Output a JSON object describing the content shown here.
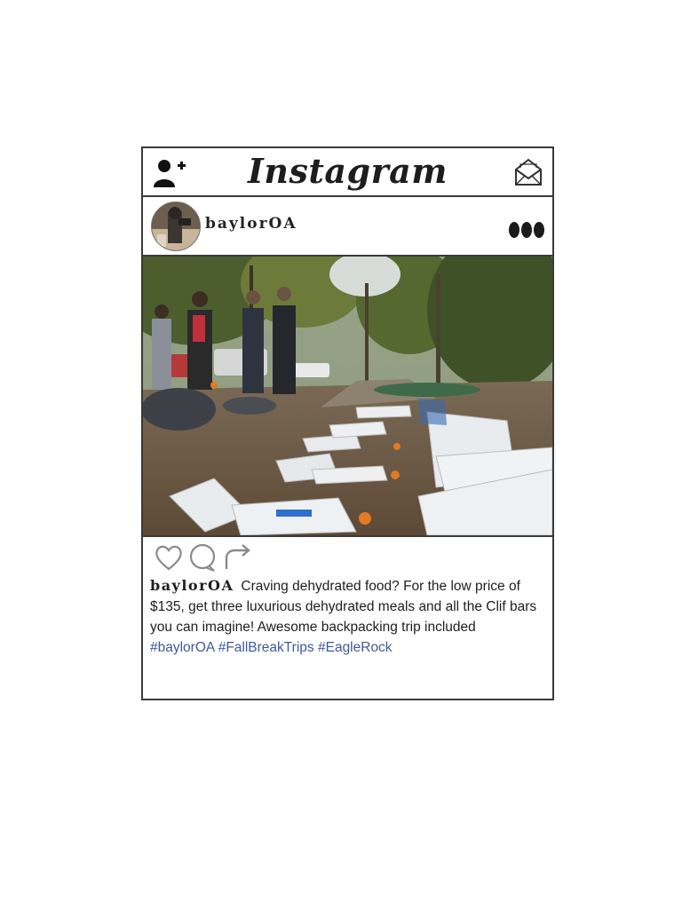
{
  "app": {
    "logo_text": "Instagram",
    "icons": {
      "add_user": "add-user-icon",
      "messages": "envelope-icon",
      "more": "more-options-icon",
      "like": "heart-icon",
      "comment": "comment-icon",
      "share": "share-arrow-icon"
    }
  },
  "post": {
    "username": "baylorOA",
    "image_description_icon": "post-photo",
    "caption": {
      "username": "baylorOA",
      "text": "Craving dehydrated food? For the low price of $135, get three luxurious dehydrated meals and all the Clif bars you can imagine! Awesome backpacking trip included",
      "hashtags": [
        "#baylorOA",
        "#FallBreakTrips",
        "#EagleRock"
      ]
    }
  },
  "colors": {
    "border": "#3a3a3a",
    "hashtag": "#3d5a9e",
    "text": "#1e1e1e"
  }
}
